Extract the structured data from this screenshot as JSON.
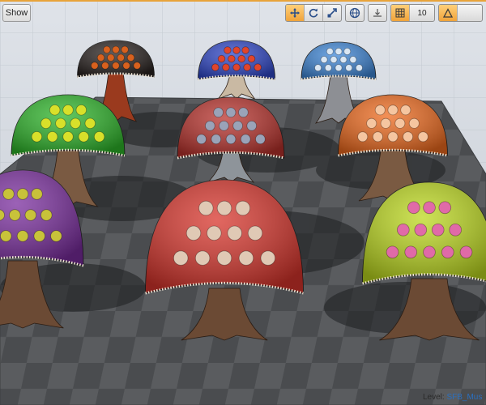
{
  "show_button": {
    "label": "Show"
  },
  "toolbar": {
    "translate_icon": "move-arrows-icon",
    "rotate_icon": "rotate-icon",
    "scale_icon": "scale-icon",
    "world_icon": "globe-icon",
    "surface_snap_icon": "surface-snap-icon",
    "grid_icon": "grid-icon",
    "grid_value": "10",
    "angle_icon": "angle-snap-icon",
    "accent_color": "#f0a33a"
  },
  "status": {
    "level_key": "Level:",
    "level_name": "SFB_Mus"
  },
  "scene": {
    "mushrooms": [
      {
        "name": "mushroom-black-orange",
        "cap_color": "#2a2321",
        "spot_color": "#d8611e",
        "stem_color": "#9a3a1e"
      },
      {
        "name": "mushroom-blue-red",
        "cap_color": "#2f47c8",
        "spot_color": "#e0452c",
        "stem_color": "#c9b9a3"
      },
      {
        "name": "mushroom-lightblue",
        "cap_color": "#3e86d6",
        "spot_color": "#d9e6f3",
        "stem_color": "#8d8f94"
      },
      {
        "name": "mushroom-green-yellow",
        "cap_color": "#2eb52a",
        "spot_color": "#d8e02a",
        "stem_color": "#7a5a42"
      },
      {
        "name": "mushroom-red-center",
        "cap_color": "#b8322c",
        "spot_color": "#9aa3b8",
        "stem_color": "#8e949a"
      },
      {
        "name": "mushroom-orange",
        "cap_color": "#ee6a1e",
        "spot_color": "#f5c5a0",
        "stem_color": "#7a5a42"
      },
      {
        "name": "mushroom-purple",
        "cap_color": "#7a2d9e",
        "spot_color": "#c8c23a",
        "stem_color": "#6b4a34"
      },
      {
        "name": "mushroom-red-front",
        "cap_color": "#d8352c",
        "spot_color": "#e0c9b5",
        "stem_color": "#6b4a34"
      },
      {
        "name": "mushroom-lime-pink",
        "cap_color": "#bcd81e",
        "spot_color": "#e06aa8",
        "stem_color": "#6b4a34"
      }
    ]
  }
}
